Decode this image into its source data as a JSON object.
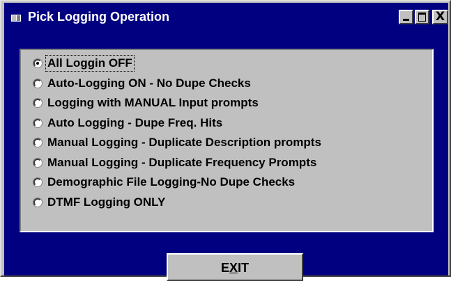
{
  "window": {
    "title": "Pick Logging Operation",
    "controls": {
      "minimize": "_",
      "maximize": "□",
      "close": "X"
    },
    "colors": {
      "titlebar": "#000080",
      "client_background": "#000080",
      "face": "#c0c0c0"
    }
  },
  "options": [
    {
      "label": "All Loggin OFF",
      "selected": true
    },
    {
      "label": "Auto-Logging ON - No Dupe Checks",
      "selected": false
    },
    {
      "label": "Logging with MANUAL Input prompts",
      "selected": false
    },
    {
      "label": "Auto Logging - Dupe Freq. Hits",
      "selected": false
    },
    {
      "label": "Manual Logging - Duplicate Description prompts",
      "selected": false
    },
    {
      "label": "Manual Logging - Duplicate Frequency Prompts",
      "selected": false
    },
    {
      "label": "Demographic File Logging-No Dupe Checks",
      "selected": false
    },
    {
      "label": "DTMF Logging ONLY",
      "selected": false
    }
  ],
  "exit_button": {
    "label_before": "E",
    "label_mnemonic": "X",
    "label_after": "IT"
  },
  "icons": {
    "app": "window-app-icon",
    "minimize": "minimize-icon",
    "maximize": "maximize-icon",
    "close": "close-icon"
  }
}
